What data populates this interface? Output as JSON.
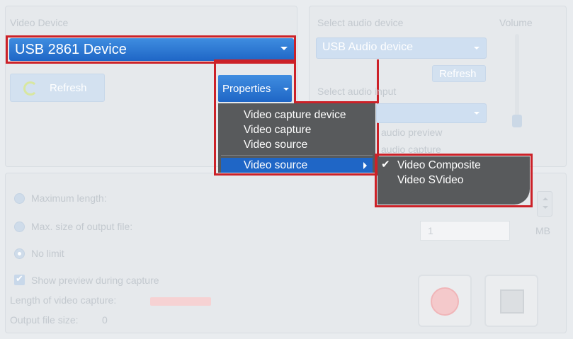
{
  "video": {
    "section_label": "Video Device",
    "device_value": "USB 2861 Device",
    "refresh_label": "Refresh",
    "properties_label": "Properties"
  },
  "properties_menu": {
    "items": [
      "Video capture device",
      "Video capture",
      "Video source"
    ],
    "highlighted": "Video source"
  },
  "submenu": {
    "items": [
      {
        "label": "Video Composite",
        "checked": true
      },
      {
        "label": "Video SVideo",
        "checked": false
      }
    ]
  },
  "audio": {
    "select_device_label": "Select audio device",
    "device_value": "USB Audio device",
    "refresh_label": "Refresh",
    "select_input_label": "Select audio input",
    "volume_label": "Volume",
    "preview_label": "audio preview",
    "capture_label": "audio capture"
  },
  "capture": {
    "max_length_label": "Maximum length:",
    "max_size_label": "Max. size of output file:",
    "size_value": "1",
    "size_unit": "MB",
    "no_limit_label": "No limit",
    "show_preview_label": "Show preview during capture",
    "length_label": "Length of video capture:",
    "output_size_label": "Output file size:",
    "output_size_value": "0"
  },
  "colors": {
    "accent_blue": "#1f66c6",
    "highlight_red": "#cc2128",
    "menu_bg": "#585a5c"
  }
}
